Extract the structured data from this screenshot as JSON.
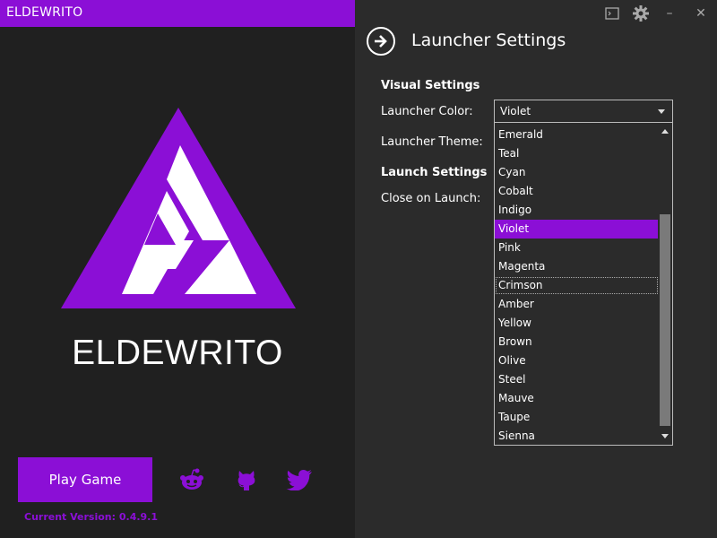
{
  "app": {
    "title": "ELDEWRITO",
    "brand": "ELDEWRITO",
    "accent_color": "#8b0fd6"
  },
  "left": {
    "play_label": "Play Game",
    "version": "Current Version: 0.4.9.1",
    "social_icons": [
      "reddit-icon",
      "github-icon",
      "twitter-icon"
    ]
  },
  "window_controls": {
    "console": "▭",
    "settings": "⚙",
    "minimize": "–",
    "close": "✕"
  },
  "settings": {
    "title": "Launcher Settings",
    "visual_section": "Visual Settings",
    "launcher_color_label": "Launcher Color:",
    "launcher_color_value": "Violet",
    "launcher_theme_label": "Launcher Theme:",
    "launch_section": "Launch Settings",
    "close_on_launch_label": "Close on Launch:"
  },
  "dropdown": {
    "options": [
      "Emerald",
      "Teal",
      "Cyan",
      "Cobalt",
      "Indigo",
      "Violet",
      "Pink",
      "Magenta",
      "Crimson",
      "Amber",
      "Yellow",
      "Brown",
      "Olive",
      "Steel",
      "Mauve",
      "Taupe",
      "Sienna"
    ],
    "selected": "Violet",
    "focused": "Crimson"
  }
}
